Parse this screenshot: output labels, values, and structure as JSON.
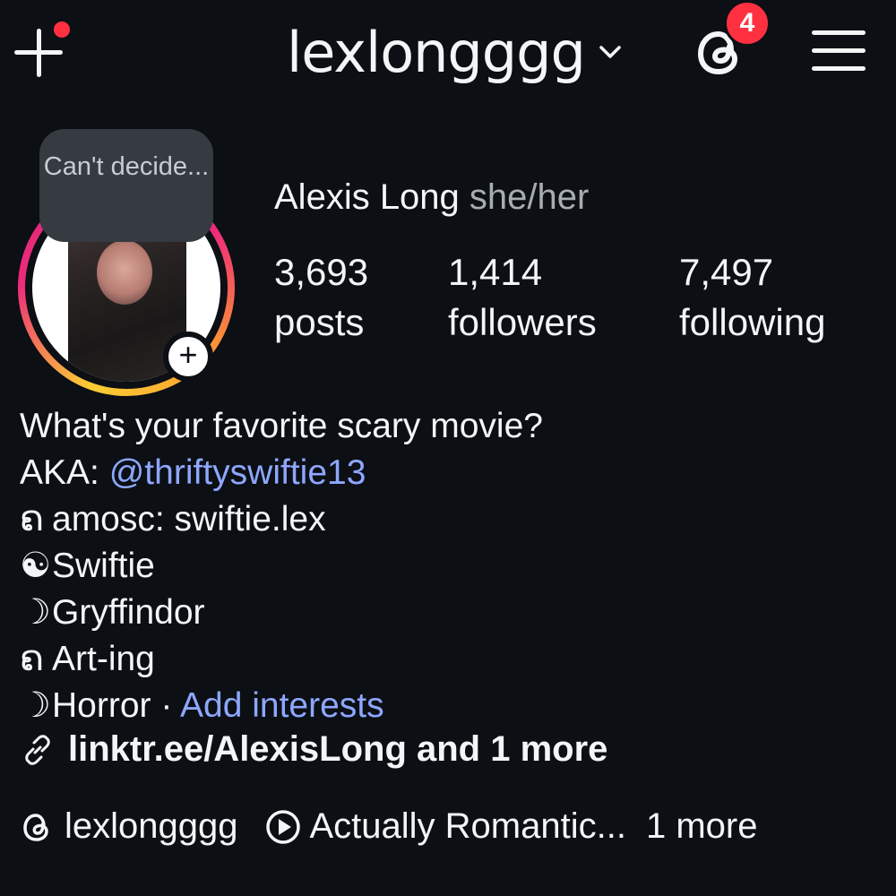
{
  "header": {
    "create_icon": "plus-icon",
    "username": "lexlongggg",
    "threads_badge_count": "4",
    "menu_icon": "hamburger-icon"
  },
  "profile": {
    "note": "Can't decide...",
    "full_name": "Alexis Long",
    "pronouns": "she/her",
    "stats": {
      "posts_count": "3,693",
      "posts_label": "posts",
      "followers_count": "1,414",
      "followers_label": "followers",
      "following_count": "7,497",
      "following_label": "following"
    }
  },
  "bio": {
    "line1": "What's your favorite scary movie?",
    "aka_prefix": "AKA: ",
    "aka_handle": "@thriftyswiftie13",
    "line3_glyph": "ຄ",
    "line3": "amosc: swiftie.lex",
    "line4_glyph": "☯",
    "line4": "Swiftie",
    "line5_glyph": "☽",
    "line5": "Gryffindor",
    "line6_glyph": "ຄ",
    "line6": "Art-ing",
    "line7_glyph": "☽",
    "line7": "Horror · ",
    "add_interests": "Add interests"
  },
  "links": {
    "text": "linktr.ee/AlexisLong and 1 more"
  },
  "bottom": {
    "threads_handle": "lexlongggg",
    "music": "Actually Romantic...",
    "more": "1 more"
  },
  "colors": {
    "background": "#0c0f14",
    "accent_blue": "#8ea7ff",
    "badge_red": "#ff3040"
  }
}
